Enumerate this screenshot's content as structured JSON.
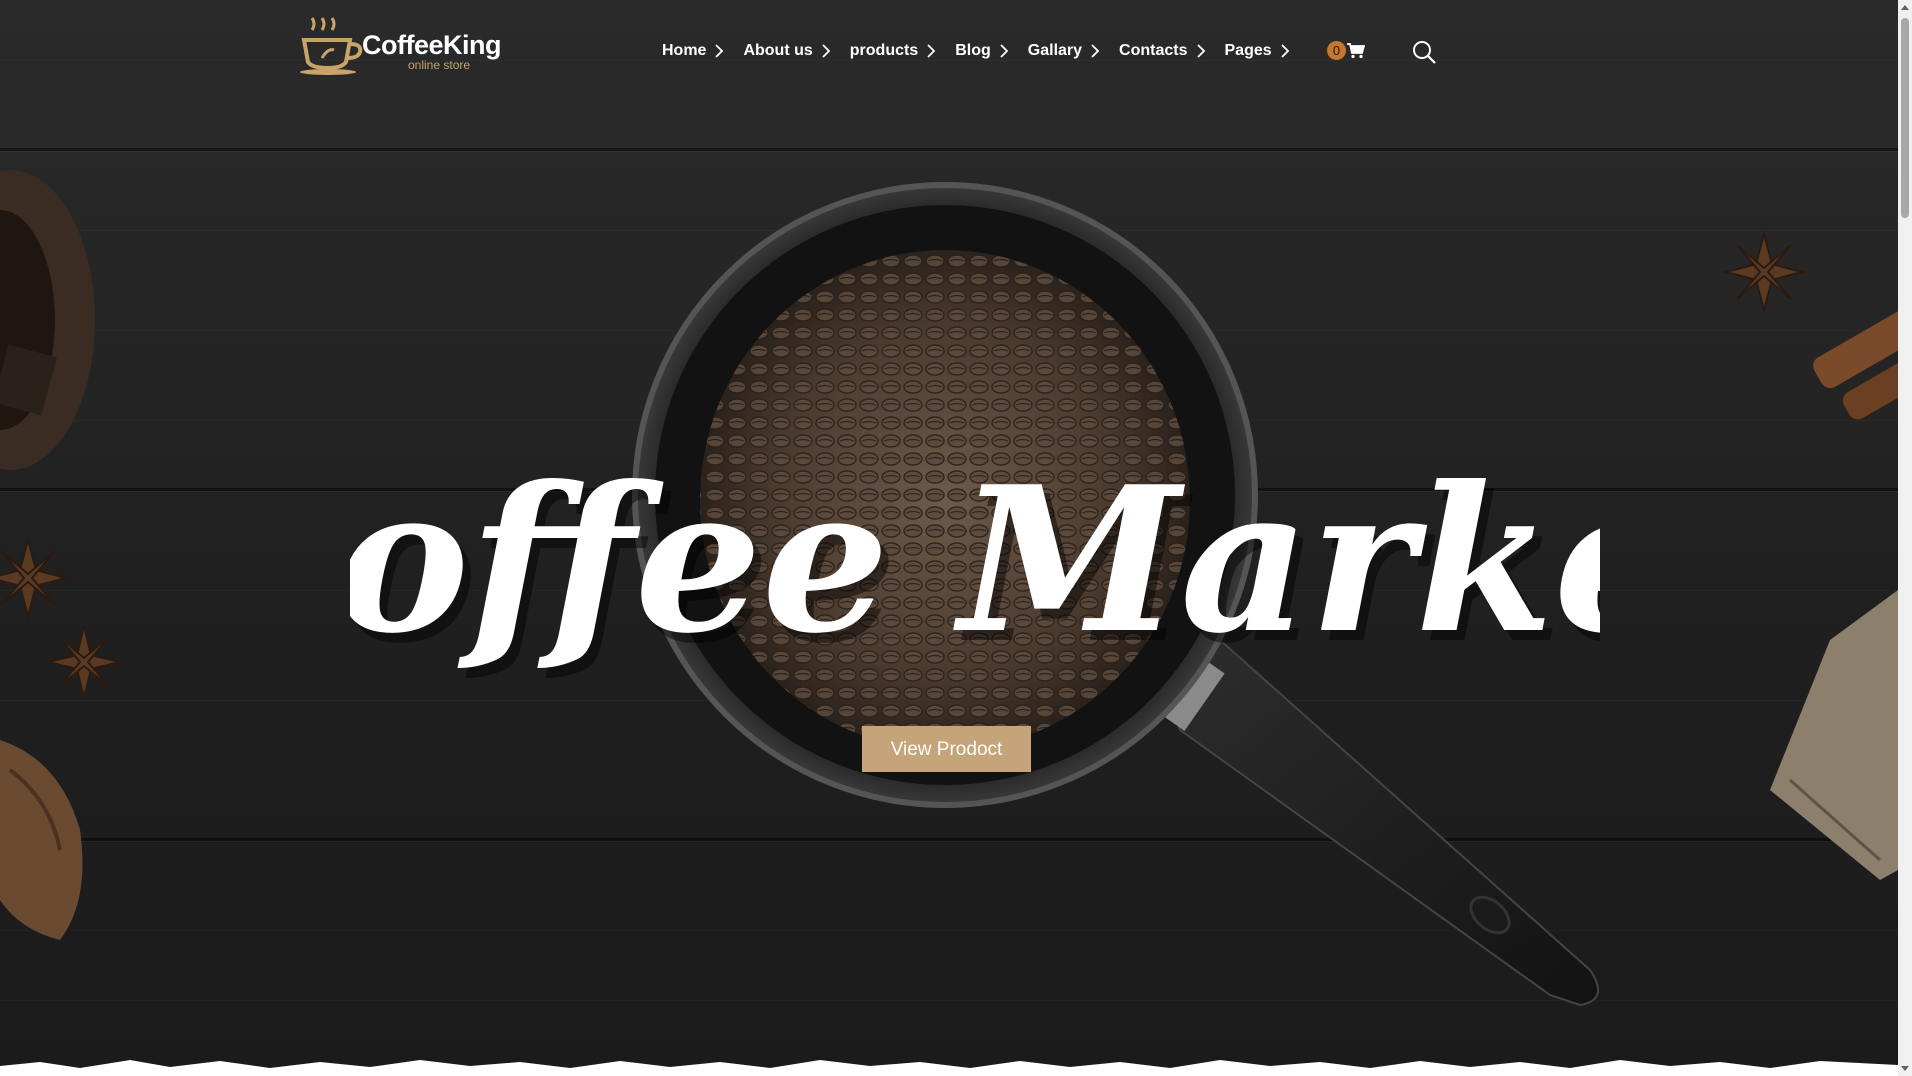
{
  "brand": {
    "name": "CoffeeKing",
    "tagline": "online store"
  },
  "nav": {
    "items": [
      {
        "label": "Home"
      },
      {
        "label": "About us"
      },
      {
        "label": "products"
      },
      {
        "label": "Blog"
      },
      {
        "label": "Gallary"
      },
      {
        "label": "Contacts"
      },
      {
        "label": "Pages"
      }
    ]
  },
  "cart": {
    "count": "0",
    "icon": "shopping-cart-icon"
  },
  "search": {
    "icon": "search-icon"
  },
  "hero": {
    "title": "Coffee Market",
    "button_label": "View Prodoct"
  },
  "colors": {
    "accent": "#c4a478",
    "badge": "#c4772d",
    "background": "#222222",
    "logo_gold": "#c9a468"
  }
}
